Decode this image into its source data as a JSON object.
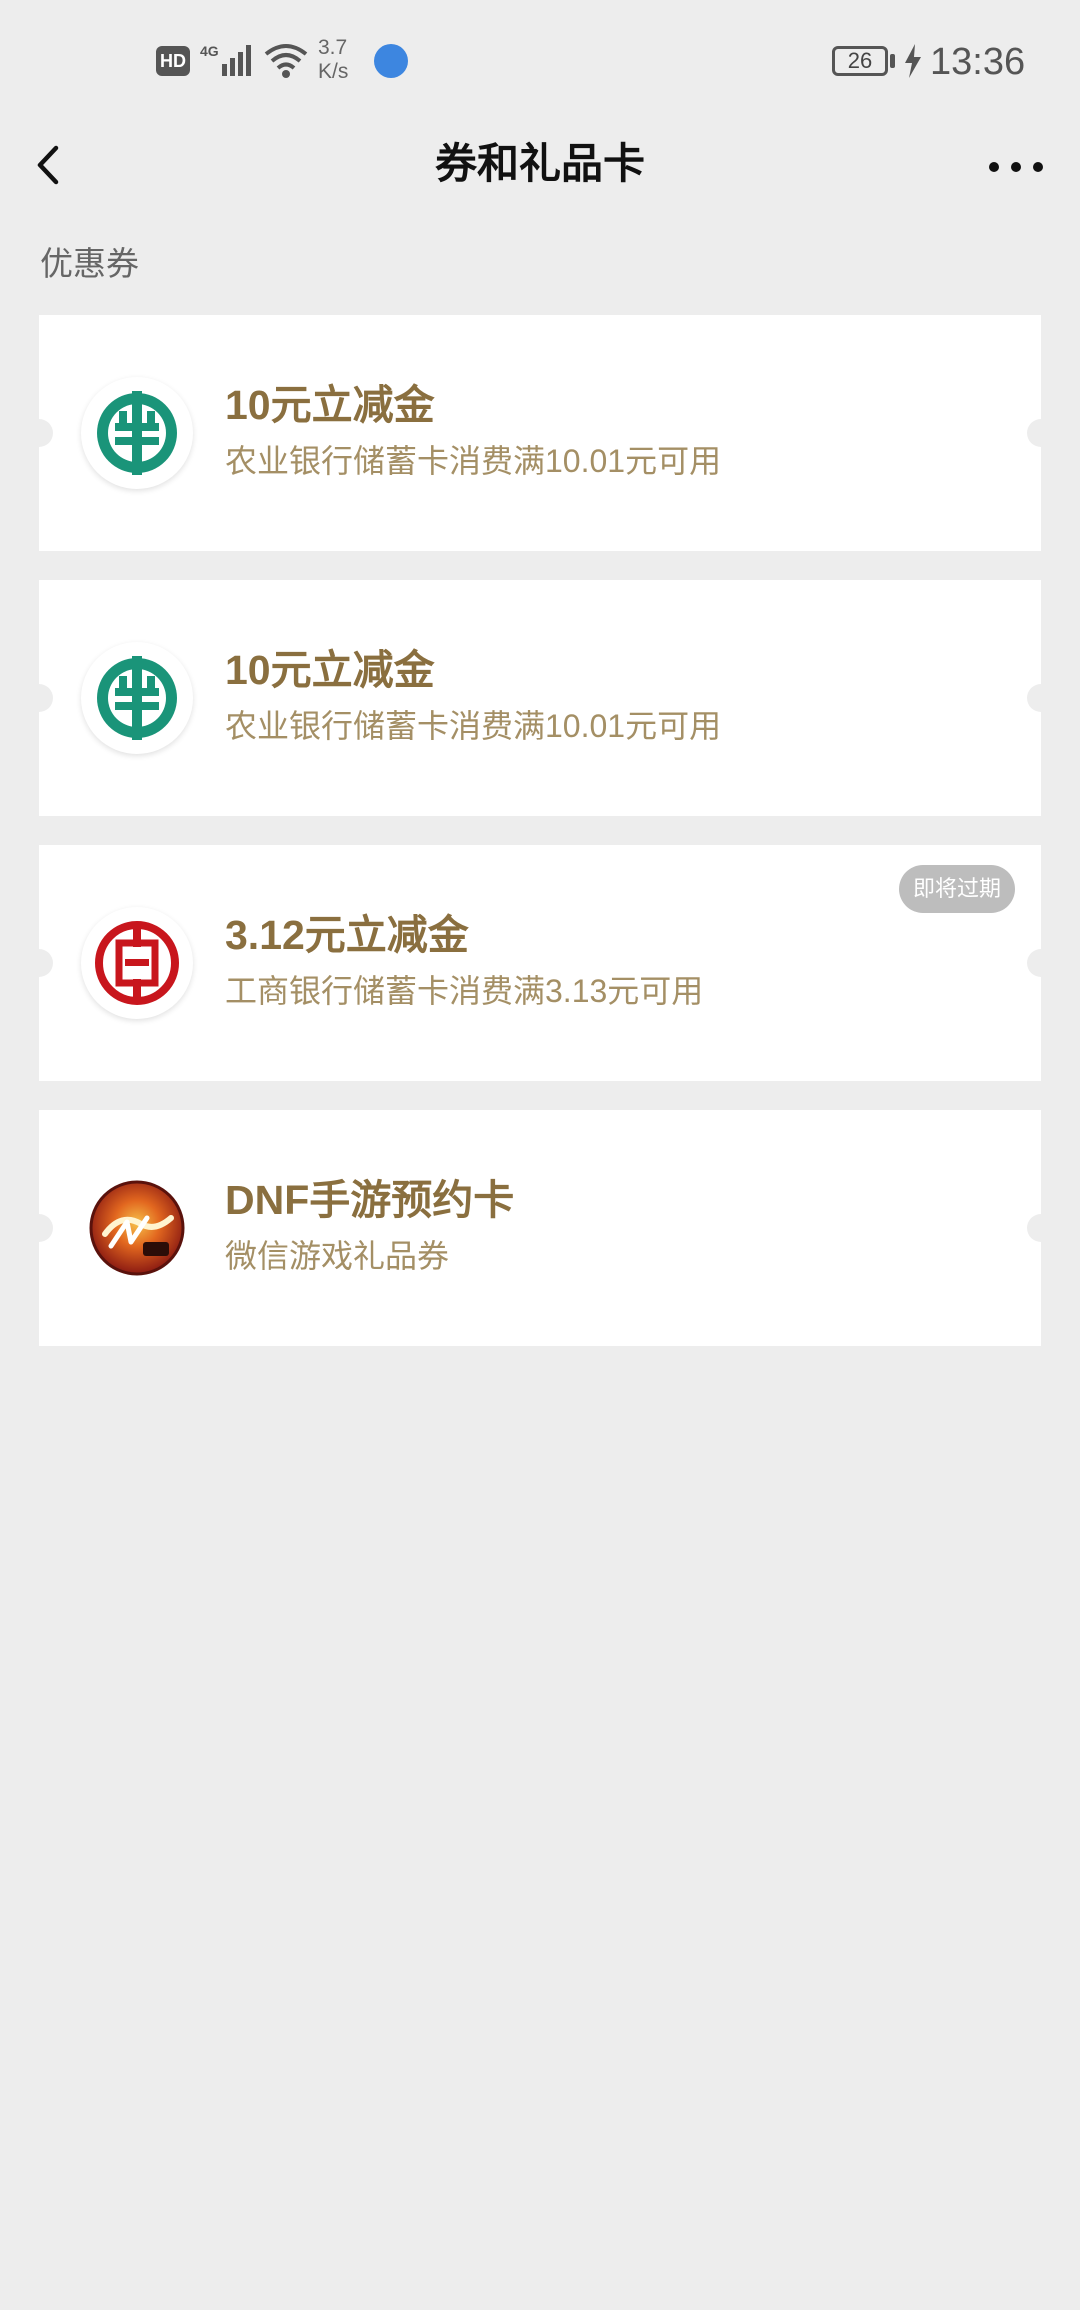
{
  "status_bar": {
    "hd": "HD",
    "network": "4G",
    "speed_value": "3.7",
    "speed_unit": "K/s",
    "battery": "26",
    "time": "13:36"
  },
  "nav": {
    "title": "券和礼品卡"
  },
  "section": {
    "label": "优惠券"
  },
  "coupons": [
    {
      "title": "10元立减金",
      "subtitle": "农业银行储蓄卡消费满10.01元可用",
      "logo": "abc-bank-icon"
    },
    {
      "title": "10元立减金",
      "subtitle": "农业银行储蓄卡消费满10.01元可用",
      "logo": "abc-bank-icon"
    },
    {
      "title": "3.12元立减金",
      "subtitle": "工商银行储蓄卡消费满3.13元可用",
      "logo": "icbc-bank-icon",
      "badge": "即将过期"
    },
    {
      "title": "DNF手游预约卡",
      "subtitle": "微信游戏礼品券",
      "logo": "dnf-game-icon"
    }
  ],
  "colors": {
    "background": "#ededed",
    "title_gold": "#8a6f3f",
    "subtitle_gold": "#a48f65",
    "abc_green": "#1a9479",
    "icbc_red": "#c8161d",
    "badge_gray": "#bdbdbd"
  }
}
